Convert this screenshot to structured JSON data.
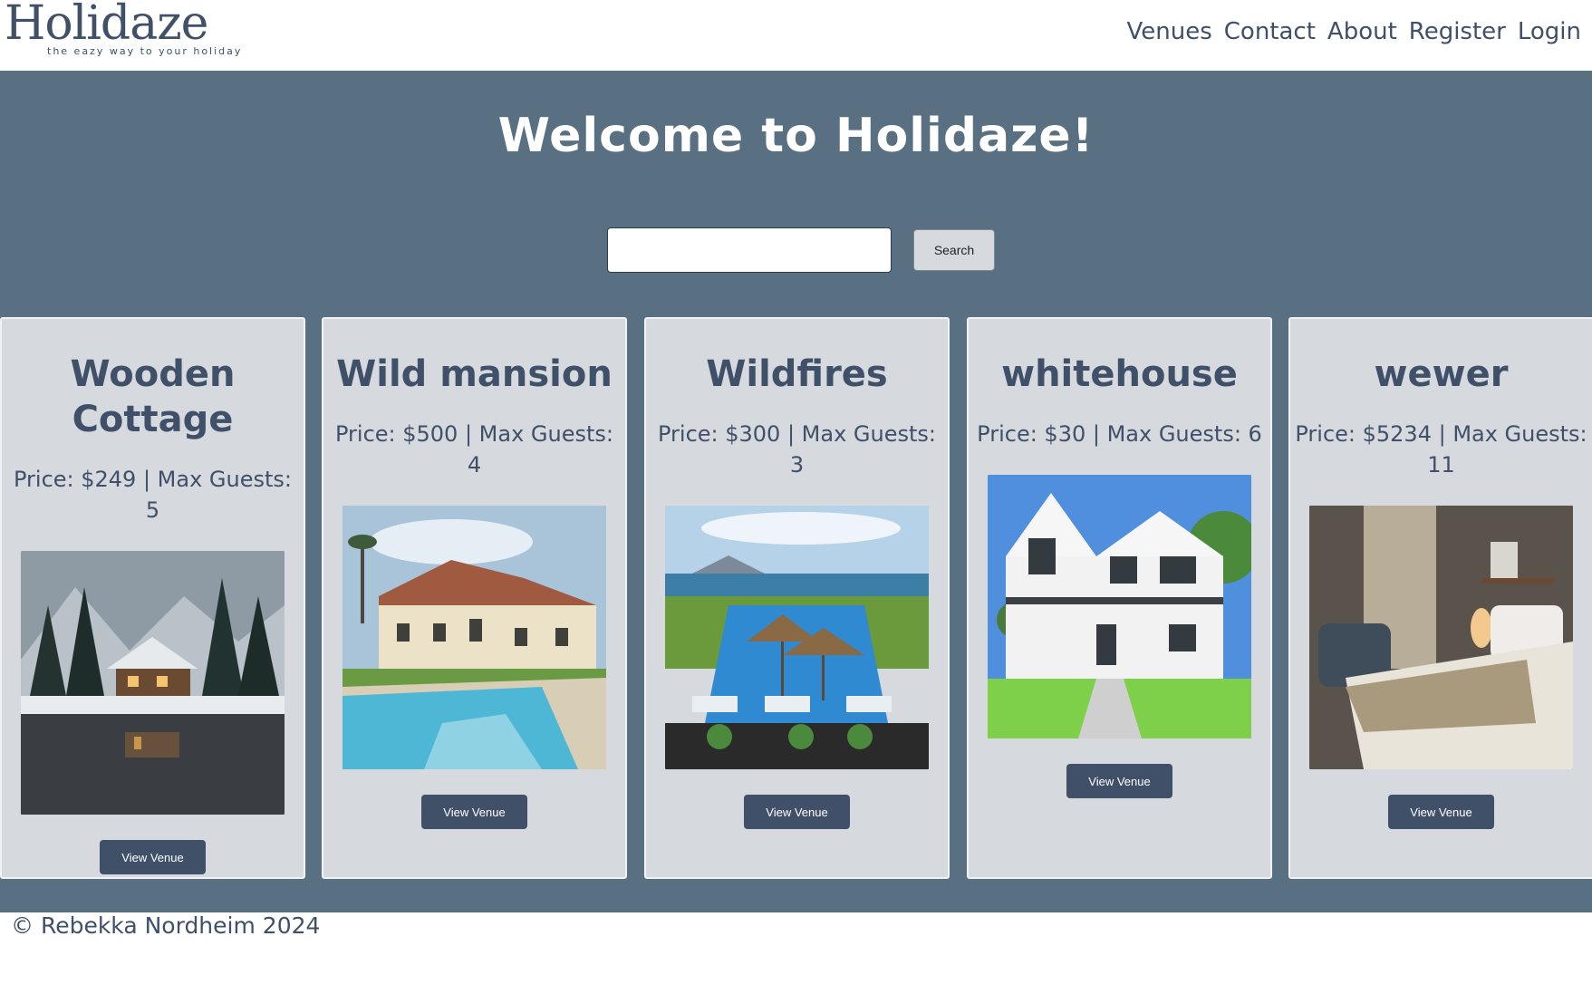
{
  "header": {
    "logo_name": "Holidaze",
    "logo_tagline": "the eazy way to your holiday",
    "nav": [
      "Venues",
      "Contact",
      "About",
      "Register",
      "Login"
    ]
  },
  "hero": {
    "title": "Welcome to Holidaze!",
    "search_value": "",
    "search_button": "Search"
  },
  "venues": [
    {
      "name": "Wooden Cottage",
      "meta": "Price: $249 | Max Guests: 5",
      "button": "View Venue",
      "image": "snowy cabin by lake"
    },
    {
      "name": "Wild mansion",
      "meta": "Price: $500 | Max Guests: 4",
      "button": "View Venue",
      "image": "mansion with pool"
    },
    {
      "name": "Wildfires",
      "meta": "Price: $300 | Max Guests: 3",
      "button": "View Venue",
      "image": "resort pool with umbrellas"
    },
    {
      "name": "whitehouse",
      "meta": "Price: $30 | Max Guests: 6",
      "button": "View Venue",
      "image": "white farmhouse"
    },
    {
      "name": "wewer",
      "meta": "Price: $5234 | Max Guests: 11",
      "button": "View Venue",
      "image": "hotel bedroom"
    }
  ],
  "footer": {
    "text": "© Rebekka Nordheim 2024"
  },
  "colors": {
    "primary": "#3f5068",
    "hero_bg": "#597083",
    "card_bg": "#d6dade"
  }
}
